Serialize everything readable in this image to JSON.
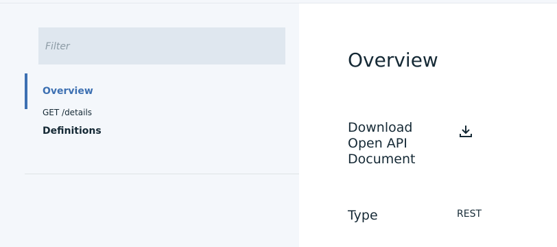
{
  "filter": {
    "placeholder": "Filter"
  },
  "sidebar": {
    "items": [
      {
        "label": "Overview",
        "active": true
      },
      {
        "label": "GET /details",
        "active": false
      },
      {
        "label": "Definitions",
        "active": false
      }
    ]
  },
  "main": {
    "title": "Overview",
    "download": {
      "label": "Download\nOpen API\nDocument",
      "icon": "download-icon"
    },
    "type": {
      "label": "Type",
      "value": "REST"
    }
  },
  "colors": {
    "accent": "#3d70b2",
    "sidebar_background": "#f4f7fb",
    "filter_background": "#dfe7ef",
    "main_background": "#ffffff",
    "text": "#152935"
  }
}
